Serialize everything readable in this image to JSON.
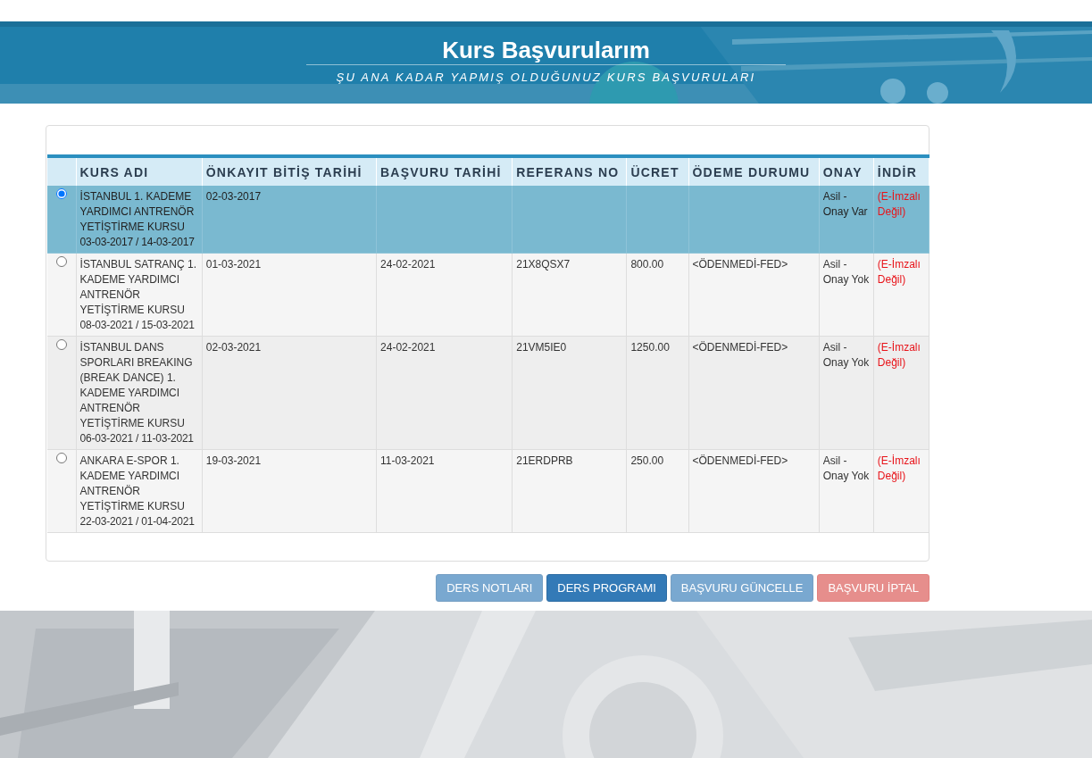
{
  "header": {
    "title": "Kurs Başvurularım",
    "subtitle": "ŞU ANA KADAR YAPMIŞ OLDUĞUNUZ KURS BAŞVURULARI"
  },
  "table": {
    "columns": [
      "KURS ADI",
      "ÖNKAYIT BİTİŞ TARİHİ",
      "BAŞVURU TARİHİ",
      "REFERANS NO",
      "ÜCRET",
      "ÖDEME DURUMU",
      "ONAY",
      "İNDİR"
    ],
    "rows": [
      {
        "selected": true,
        "course": "İSTANBUL 1. KADEME YARDIMCI ANTRENÖR YETİŞTİRME KURSU",
        "dates": "03-03-2017 / 14-03-2017",
        "preregistration_end": "02-03-2017",
        "approval": "Asil - Onay Var",
        "download": "(E-İmzalı Değil)"
      },
      {
        "selected": false,
        "course": "İSTANBUL SATRANÇ 1. KADEME YARDIMCI ANTRENÖR YETİŞTİRME KURSU",
        "dates": "08-03-2021 / 15-03-2021",
        "preregistration_end": "01-03-2021",
        "application_date": "24-02-2021",
        "reference_no": "21X8QSX7",
        "fee": "800.00",
        "payment_status": "<ÖDENMEDİ-FED>",
        "approval": "Asil - Onay Yok",
        "download": "(E-İmzalı Değil)"
      },
      {
        "selected": false,
        "course": "İSTANBUL DANS SPORLARI BREAKING (BREAK DANCE) 1. KADEME YARDIMCI ANTRENÖR YETİŞTİRME KURSU",
        "dates": "06-03-2021 / 11-03-2021",
        "preregistration_end": "02-03-2021",
        "application_date": "24-02-2021",
        "reference_no": "21VM5IE0",
        "fee": "1250.00",
        "payment_status": "<ÖDENMEDİ-FED>",
        "approval": "Asil - Onay Yok",
        "download": "(E-İmzalı Değil)"
      },
      {
        "selected": false,
        "course": "ANKARA E-SPOR 1. KADEME YARDIMCI ANTRENÖR YETİŞTİRME KURSU",
        "dates": "22-03-2021 / 01-04-2021",
        "preregistration_end": "19-03-2021",
        "application_date": "11-03-2021",
        "reference_no": "21ERDPRB",
        "fee": "250.00",
        "payment_status": "<ÖDENMEDİ-FED>",
        "approval": "Asil - Onay Yok",
        "download": "(E-İmzalı Değil)"
      }
    ]
  },
  "buttons": [
    {
      "label": "DERS NOTLARI",
      "kind": "primary",
      "disabled": true
    },
    {
      "label": "DERS PROGRAMI",
      "kind": "primary",
      "disabled": false
    },
    {
      "label": "BAŞVURU GÜNCELLE",
      "kind": "primary",
      "disabled": true
    },
    {
      "label": "BAŞVURU İPTAL",
      "kind": "danger",
      "disabled": true
    }
  ]
}
